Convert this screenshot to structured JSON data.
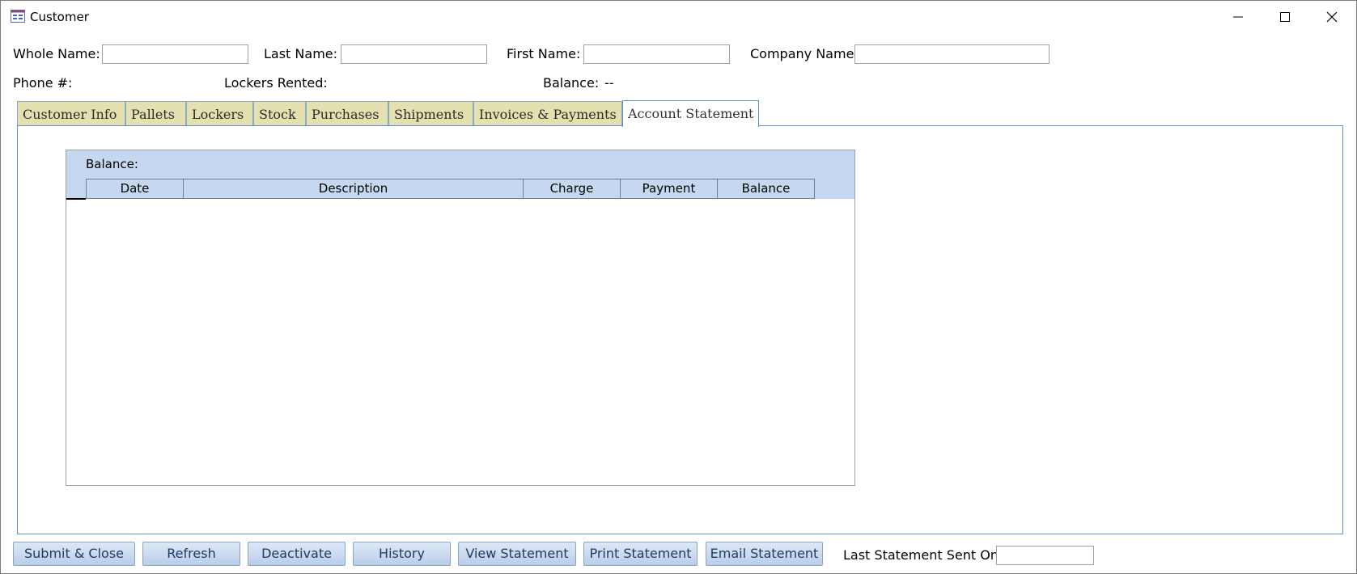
{
  "window": {
    "title": "Customer"
  },
  "header": {
    "whole_name_label": "Whole Name:",
    "whole_name_value": "",
    "last_name_label": "Last Name:",
    "last_name_value": "",
    "first_name_label": "First Name:",
    "first_name_value": "",
    "company_name_label": "Company Name:",
    "company_name_value": "",
    "phone_label": "Phone #:",
    "lockers_rented_label": "Lockers Rented:",
    "balance_label": "Balance:",
    "balance_value": "--"
  },
  "tabs": [
    {
      "label": "Customer Info"
    },
    {
      "label": "Pallets"
    },
    {
      "label": "Lockers"
    },
    {
      "label": "Stock"
    },
    {
      "label": "Purchases"
    },
    {
      "label": "Shipments"
    },
    {
      "label": "Invoices & Payments"
    },
    {
      "label": "Account Statement",
      "active": true
    }
  ],
  "statement": {
    "balance_label": "Balance:",
    "columns": [
      "Date",
      "Description",
      "Charge",
      "Payment",
      "Balance"
    ],
    "rows": []
  },
  "footer": {
    "buttons": [
      "Submit & Close",
      "Refresh",
      "Deactivate",
      "History",
      "View Statement",
      "Print Statement",
      "Email Statement"
    ],
    "last_statement_label": "Last Statement Sent On:",
    "last_statement_value": ""
  },
  "colors": {
    "tab_inactive": "#e4e0b0",
    "accent_border": "#5b8fd0",
    "subform_header": "#c6d8ef",
    "button_text": "#1f3b66"
  },
  "icons": [
    "form-icon",
    "minimize-icon",
    "maximize-icon",
    "close-icon"
  ]
}
